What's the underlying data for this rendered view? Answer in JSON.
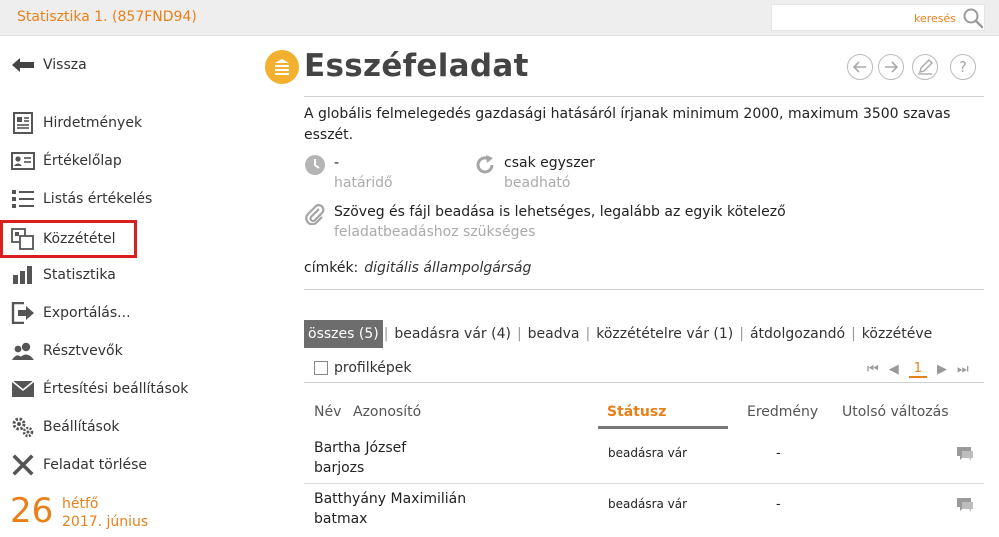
{
  "app": {
    "title": "Statisztika 1. (857FND94)"
  },
  "search": {
    "placeholder": "keresés"
  },
  "sidebar": {
    "back": "Vissza",
    "items": [
      {
        "label": "Hirdetmények",
        "icon": "document-icon"
      },
      {
        "label": "Értékelőlap",
        "icon": "id-card-icon"
      },
      {
        "label": "Listás értékelés",
        "icon": "list-icon"
      },
      {
        "label": "Közzététel",
        "icon": "publish-icon"
      },
      {
        "label": "Statisztika",
        "icon": "bar-chart-icon"
      },
      {
        "label": "Exportálás...",
        "icon": "export-icon"
      },
      {
        "label": "Résztvevők",
        "icon": "users-icon"
      },
      {
        "label": "Értesítési beállítások",
        "icon": "mail-icon"
      },
      {
        "label": "Beállítások",
        "icon": "gears-icon"
      },
      {
        "label": "Feladat törlése",
        "icon": "x-icon"
      }
    ],
    "highlight_color": "#d9201e"
  },
  "date": {
    "day": "26",
    "weekday": "hétfő",
    "month": "2017. június"
  },
  "task": {
    "title": "Esszéfeladat",
    "description": "A globális felmelegedés gazdasági hatásáról írjanak minimum 2000, maximum 3500 szavas esszét.",
    "deadline_value": "-",
    "deadline_label": "határidő",
    "submit_value": "csak egyszer",
    "submit_label": "beadható",
    "req_value": "Szöveg és fájl beadása is lehetséges, legalább az egyik kötelező",
    "req_label": "feladatbeadáshoz szükséges",
    "tags_label": "címkék:",
    "tags_value": "digitális állampolgárság"
  },
  "filters": [
    {
      "label": "összes (5)",
      "active": true
    },
    {
      "label": "beadásra vár (4)",
      "active": false
    },
    {
      "label": "beadva",
      "active": false
    },
    {
      "label": "közzétételre vár (1)",
      "active": false
    },
    {
      "label": "átdolgozandó",
      "active": false
    },
    {
      "label": "közzétéve",
      "active": false
    }
  ],
  "profile_images": "profilképek",
  "pager": {
    "page": "1"
  },
  "table": {
    "columns": {
      "name": "Név",
      "id": "Azonosító",
      "status": "Státusz",
      "result": "Eredmény",
      "last_change": "Utolsó változás"
    },
    "rows": [
      {
        "name": "Bartha József",
        "id": "barjozs",
        "status": "beadásra vár",
        "result": "-"
      },
      {
        "name": "Batthyány Maximilián",
        "id": "batmax",
        "status": "beadásra vár",
        "result": "-"
      }
    ]
  },
  "colors": {
    "accent": "#e8801a",
    "icon_badge": "#f2b02e",
    "topbar": "#eeeeee"
  }
}
